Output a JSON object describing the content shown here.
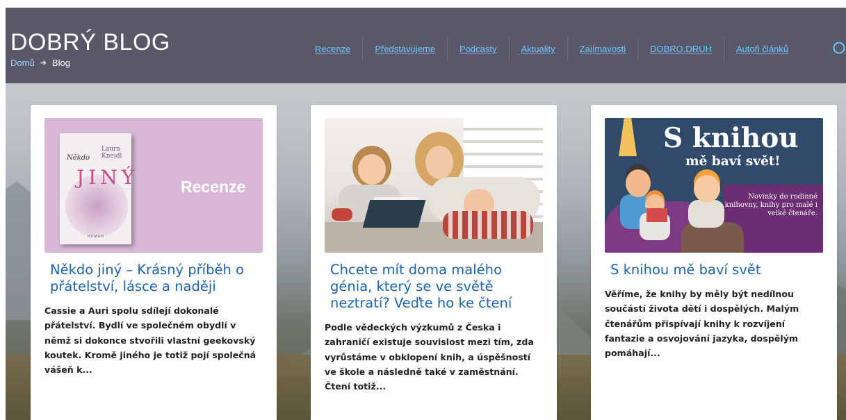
{
  "header": {
    "brand": "DOBRÝ BLOG",
    "breadcrumb": {
      "home": "Domů",
      "separator": "➜",
      "current": "Blog"
    },
    "nav": [
      "Recenze",
      "Představujeme",
      "Podcasty",
      "Aktuality",
      "Zajímavosti",
      "DOBRO.DRUH",
      "Autoři článků"
    ],
    "search_icon": "search-icon"
  },
  "colors": {
    "header_bg": "#585868",
    "nav_link": "#6fc3ff",
    "title_link": "#1b63b0",
    "body_text": "#222222"
  },
  "cards": [
    {
      "image": {
        "book_author": "Laura Kneidl",
        "book_title_small": "Někdo",
        "book_title_big": "JINÝ",
        "book_footer": "ROMÁN",
        "label": "Recenze"
      },
      "title": "Někdo jiný – Krásný příběh o přátelství, lásce a naději",
      "excerpt": "Cassie a Auri spolu sdílejí dokonalé přátelství. Bydlí ve společném obydlí v němž si dokonce stvořili vlastní geekovský koutek. Kromě jiného je totiž pojí společná vášeň k..."
    },
    {
      "image": {},
      "title": "Chcete mít doma malého génia, který se ve světě neztratí? Veďte ho ke čtení",
      "excerpt": "Podle vědeckých výzkumů z Česka i zahraničí existuje souvislost mezi tím, zda vyrůstáme v obklopení knih, a úspěšností ve škole a následně také v zaměstnání. Čtení totiž..."
    },
    {
      "image": {
        "headline": "S knihou",
        "subheadline": "mě baví svět!",
        "panel_text": "Novinky do rodinné knihovny, knihy pro malé i velké čtenáře."
      },
      "title": "S knihou mě baví svět",
      "excerpt": "Věříme, že knihy by měly být nedílnou součástí života dětí i dospělých. Malým čtenářům přispívají knihy k rozvíjení fantazie a osvojování jazyka, dospělým pomáhají..."
    }
  ]
}
